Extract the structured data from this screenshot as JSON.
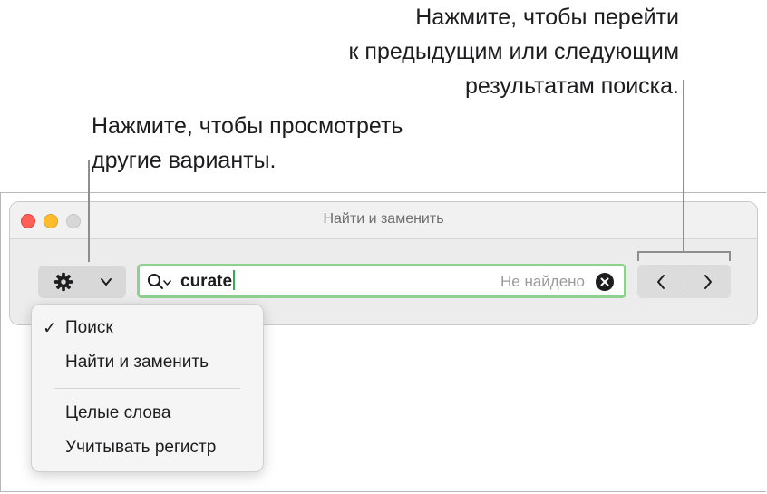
{
  "callouts": {
    "nav_line1": "Нажмите, чтобы перейти",
    "nav_line2": "к предыдущим или следующим",
    "nav_line3": "результатам поиска.",
    "options_line1": "Нажмите, чтобы просмотреть",
    "options_line2": "другие варианты."
  },
  "window": {
    "title": "Найти и заменить"
  },
  "toolbar": {
    "gear_icon": "gear-icon",
    "options_chevron": "chevron-down-icon"
  },
  "search": {
    "value": "curate",
    "status": "Не найдено",
    "search_icon": "magnifier-with-chevron-icon",
    "clear_icon": "clear-circle-icon"
  },
  "navigation": {
    "previous_icon": "chevron-left-icon",
    "next_icon": "chevron-right-icon"
  },
  "menu": {
    "check_mark": "✓",
    "items": [
      {
        "label": "Поиск",
        "checked": true
      },
      {
        "label": "Найти и заменить",
        "checked": false
      },
      {
        "label": "Целые слова",
        "checked": false
      },
      {
        "label": "Учитывать регистр",
        "checked": false
      }
    ]
  },
  "colors": {
    "search_focus_ring": "#8fd08e",
    "traffic_close": "#fe5f57",
    "traffic_minimize": "#febc2e"
  }
}
